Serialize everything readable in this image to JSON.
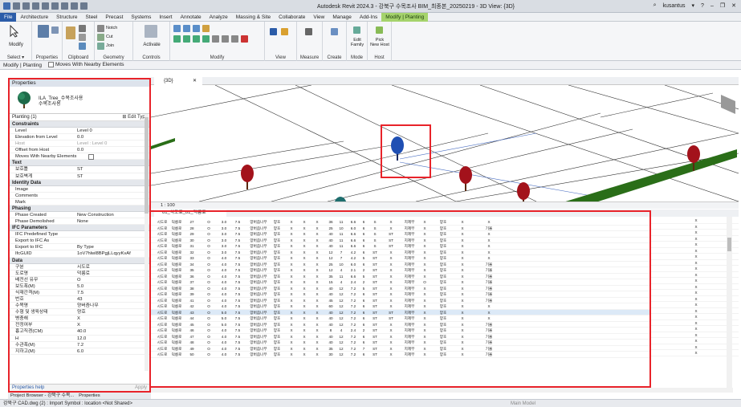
{
  "titlebar": {
    "app_title": "Autodesk Revit 2024.3 - 강북구 수목조사 BIM_최종본_20250219 - 3D View: {3D}",
    "user": "kusantus"
  },
  "ribbon_tabs": [
    "File",
    "Architecture",
    "Structure",
    "Steel",
    "Precast",
    "Systems",
    "Insert",
    "Annotate",
    "Analyze",
    "Massing & Site",
    "Collaborate",
    "View",
    "Manage",
    "Add-Ins",
    "Modify | Planting"
  ],
  "ribbon_groups": [
    "Select ▾",
    "Properties",
    "Clipboard",
    "Geometry",
    "Controls",
    "Modify",
    "View",
    "Measure",
    "Create",
    "Mode",
    "Host"
  ],
  "ribbon_labels": {
    "modify": "Modify",
    "cut": "Cut",
    "join": "Join",
    "notch": "Notch",
    "activate": "Activate",
    "edit_family": "Edit\nFamily",
    "pick_new_host": "Pick\nNew Host"
  },
  "options_bar": {
    "context": "Modify | Planting",
    "moves_with_nearby": "Moves With Nearby Elements"
  },
  "properties": {
    "header": "Properties",
    "type_name1": "ILA_Tree_수목조사용",
    "type_name2": "수목조사용",
    "instance": "Planting (1)",
    "edit_type": "Edit Type",
    "groups": [
      {
        "name": "Constraints",
        "rows": [
          [
            "Level",
            "Level 0"
          ],
          [
            "Elevation from Level",
            "0.0"
          ],
          [
            "Host",
            "Level : Level 0"
          ],
          [
            "Offset from Host",
            "0.0"
          ],
          [
            "Moves With Nearby Elements",
            ""
          ]
        ]
      },
      {
        "name": "Text",
        "rows": [
          [
            "보호틀",
            "ST"
          ],
          [
            "보호벽게",
            "ST"
          ]
        ]
      },
      {
        "name": "Identity Data",
        "rows": [
          [
            "Image",
            ""
          ],
          [
            "Comments",
            ""
          ],
          [
            "Mark",
            ""
          ]
        ]
      },
      {
        "name": "Phasing",
        "rows": [
          [
            "Phase Created",
            "New Construction"
          ],
          [
            "Phase Demolished",
            "None"
          ]
        ]
      },
      {
        "name": "IFC Parameters",
        "rows": [
          [
            "IFC Predefined Type",
            ""
          ],
          [
            "Export to IFC As",
            ""
          ],
          [
            "Export to IFC",
            "By Type"
          ],
          [
            "IfcGUID",
            "1oV7hlwl8BPgjLLqyyKvAf"
          ]
        ]
      },
      {
        "name": "Data",
        "rows": [
          [
            "구분",
            "시도로"
          ],
          [
            "도로명",
            "덕릉로"
          ],
          [
            "배전선 유무",
            "O"
          ],
          [
            "보도폭(M)",
            "5.0"
          ],
          [
            "식재간격(M)",
            "7.5"
          ],
          [
            "번호",
            "43"
          ],
          [
            "수목명",
            "양버즘나무"
          ],
          [
            "수형 및 생육상태",
            "양호"
          ],
          [
            "병충해",
            "X"
          ],
          [
            "전정여부",
            "X"
          ],
          [
            "흉고직경(CM)",
            "40.0"
          ],
          [
            "H",
            "12.0"
          ],
          [
            "수관폭(M)",
            "7.2"
          ],
          [
            "지하고(M)",
            "6.0"
          ]
        ]
      }
    ],
    "help": "Properties help",
    "apply": "Apply"
  },
  "bottom_tabs": [
    "Project Browser - 강북구 수목...",
    "Properties"
  ],
  "view": {
    "tab": "{3D}",
    "scale": "1 : 100"
  },
  "schedule": {
    "tab": "01_식도로_01_덕릉로",
    "rows": [
      [
        "시도로",
        "덕릉로",
        "27",
        "O",
        "3.0",
        "7.5",
        "양버즘나무",
        "양호",
        "X",
        "X",
        "X",
        "36",
        "11",
        "6.6",
        "6",
        "S",
        "X",
        "지제부",
        "X",
        "양호",
        "X",
        "X",
        "X"
      ],
      [
        "시도로",
        "덕릉로",
        "28",
        "O",
        "3.0",
        "7.5",
        "양버즘나무",
        "양호",
        "X",
        "X",
        "X",
        "25",
        "10",
        "6.0",
        "6",
        "S",
        "X",
        "지제부",
        "X",
        "양호",
        "X",
        "기울",
        "X"
      ],
      [
        "시도로",
        "덕릉로",
        "29",
        "O",
        "3.0",
        "7.5",
        "양버즘나무",
        "양호",
        "X",
        "X",
        "X",
        "40",
        "11",
        "6.6",
        "6",
        "S",
        "ST",
        "지제부",
        "X",
        "양호",
        "X",
        "X",
        "X"
      ],
      [
        "시도로",
        "덕릉로",
        "30",
        "O",
        "3.0",
        "7.5",
        "양버즘나무",
        "양호",
        "X",
        "X",
        "X",
        "40",
        "11",
        "6.6",
        "6",
        "S",
        "ST",
        "지제부",
        "X",
        "양호",
        "X",
        "X",
        "X"
      ],
      [
        "시도로",
        "덕릉로",
        "31",
        "O",
        "3.0",
        "7.5",
        "양버즘나무",
        "양호",
        "X",
        "X",
        "X",
        "40",
        "11",
        "6.6",
        "6",
        "S",
        "ST",
        "지제부",
        "X",
        "양호",
        "X",
        "X",
        "X"
      ],
      [
        "시도로",
        "덕릉로",
        "32",
        "O",
        "3.0",
        "7.5",
        "양버즘나무",
        "양호",
        "X",
        "X",
        "X",
        "12",
        "7",
        "4.2",
        "6",
        "ST",
        "X",
        "지제부",
        "X",
        "양호",
        "X",
        "X",
        "X"
      ],
      [
        "시도로",
        "덕릉로",
        "33",
        "O",
        "4.0",
        "7.5",
        "양버즘나무",
        "양호",
        "X",
        "X",
        "X",
        "12",
        "7",
        "4.2",
        "5",
        "ST",
        "X",
        "지제부",
        "X",
        "양호",
        "X",
        "X",
        "X"
      ],
      [
        "시도로",
        "덕릉로",
        "34",
        "O",
        "4.0",
        "7.5",
        "양버즘나무",
        "양호",
        "X",
        "X",
        "X",
        "25",
        "10",
        "6.0",
        "6",
        "ST",
        "X",
        "지제부",
        "X",
        "양호",
        "X",
        "기울",
        "X"
      ],
      [
        "시도로",
        "덕릉로",
        "35",
        "O",
        "4.0",
        "7.5",
        "양버즘나무",
        "양호",
        "X",
        "X",
        "X",
        "12",
        "4",
        "2.1",
        "2",
        "ST",
        "X",
        "지제부",
        "X",
        "양호",
        "X",
        "기울",
        "X"
      ],
      [
        "시도로",
        "덕릉로",
        "36",
        "O",
        "4.0",
        "7.5",
        "양버즘나무",
        "양호",
        "X",
        "X",
        "X",
        "35",
        "11",
        "6.6",
        "5",
        "ST",
        "X",
        "지제부",
        "X",
        "양호",
        "X",
        "기울",
        "X"
      ],
      [
        "시도로",
        "덕릉로",
        "37",
        "O",
        "4.0",
        "7.5",
        "양버즘나무",
        "양호",
        "X",
        "X",
        "X",
        "15",
        "4",
        "2.4",
        "2",
        "ST",
        "X",
        "지제부",
        "O",
        "양호",
        "X",
        "기울",
        "X"
      ],
      [
        "시도로",
        "덕릉로",
        "38",
        "O",
        "4.0",
        "7.5",
        "양버즘나무",
        "양호",
        "X",
        "X",
        "X",
        "40",
        "12",
        "7.2",
        "5",
        "ST",
        "X",
        "지제부",
        "X",
        "양호",
        "X",
        "기울",
        "X"
      ],
      [
        "시도로",
        "덕릉로",
        "39",
        "O",
        "4.0",
        "7.5",
        "양버즘나무",
        "양호",
        "X",
        "X",
        "X",
        "40",
        "12",
        "7.2",
        "6",
        "ST",
        "X",
        "지제부",
        "X",
        "양호",
        "X",
        "기울",
        "X"
      ],
      [
        "시도로",
        "덕릉로",
        "41",
        "O",
        "4.0",
        "7.5",
        "양버즘나무",
        "양호",
        "X",
        "X",
        "X",
        "45",
        "12",
        "7.2",
        "6",
        "ST",
        "X",
        "지제부",
        "X",
        "양호",
        "X",
        "기울",
        "X"
      ],
      [
        "시도로",
        "덕릉로",
        "42",
        "O",
        "4.0",
        "7.5",
        "양버즘나무",
        "양호",
        "X",
        "X",
        "X",
        "60",
        "12",
        "7.2",
        "6",
        "ST",
        "X",
        "지제부",
        "X",
        "양호",
        "X",
        "X",
        "X"
      ],
      [
        "시도로",
        "덕릉로",
        "43",
        "O",
        "5.0",
        "7.5",
        "양버즘나무",
        "양호",
        "X",
        "X",
        "X",
        "40",
        "12",
        "7.2",
        "6",
        "ST",
        "ST",
        "지제부",
        "X",
        "양호",
        "X",
        "X",
        "X"
      ],
      [
        "시도로",
        "덕릉로",
        "44",
        "O",
        "5.0",
        "7.5",
        "양버즘나무",
        "양호",
        "X",
        "X",
        "X",
        "40",
        "12",
        "7.2",
        "6",
        "ST",
        "ST",
        "지제부",
        "X",
        "양호",
        "X",
        "X",
        "X"
      ],
      [
        "시도로",
        "덕릉로",
        "45",
        "O",
        "5.0",
        "7.5",
        "양버즘나무",
        "양호",
        "X",
        "X",
        "X",
        "40",
        "12",
        "7.2",
        "6",
        "ST",
        "X",
        "지제부",
        "X",
        "양호",
        "X",
        "기울",
        "X"
      ],
      [
        "시도로",
        "덕릉로",
        "46",
        "O",
        "4.0",
        "7.5",
        "양버즘나무",
        "양호",
        "X",
        "X",
        "X",
        "8",
        "4",
        "2.4",
        "2",
        "ST",
        "X",
        "지제부",
        "X",
        "양호",
        "X",
        "기울",
        "X"
      ],
      [
        "시도로",
        "덕릉로",
        "47",
        "O",
        "4.0",
        "7.5",
        "양버즘나무",
        "양호",
        "X",
        "X",
        "X",
        "40",
        "12",
        "7.2",
        "6",
        "ST",
        "X",
        "지제부",
        "X",
        "양호",
        "X",
        "기울",
        "X"
      ],
      [
        "시도로",
        "덕릉로",
        "48",
        "O",
        "4.0",
        "7.5",
        "양버즘나무",
        "양호",
        "X",
        "X",
        "X",
        "40",
        "12",
        "7.2",
        "6",
        "ST",
        "X",
        "지제부",
        "X",
        "양호",
        "X",
        "기울",
        "X"
      ],
      [
        "시도로",
        "덕릉로",
        "49",
        "O",
        "4.0",
        "7.5",
        "양버즘나무",
        "양호",
        "X",
        "X",
        "X",
        "35",
        "12",
        "7.2",
        "7",
        "ST",
        "X",
        "지제부",
        "X",
        "양호",
        "X",
        "기울",
        "X"
      ],
      [
        "시도로",
        "덕릉로",
        "50",
        "O",
        "4.0",
        "7.5",
        "양버즘나무",
        "양호",
        "X",
        "X",
        "X",
        "30",
        "12",
        "7.2",
        "6",
        "ST",
        "X",
        "지제부",
        "X",
        "양호",
        "X",
        "기울",
        "X"
      ]
    ],
    "selected_row_index": 15
  },
  "status": {
    "text": "강북구 CAD.dwg (2) : Import Symbol : location <Not Shared>",
    "model": "Main Model"
  },
  "colors": {
    "highlight": "#e8232a",
    "tree_red": "#a3121b",
    "tree_blue": "#1f4fb3",
    "tree_teal": "#1e6e6e",
    "hedge": "#2a6e18",
    "file_tab": "#2b5ca8",
    "context_tab": "#a5d36c"
  }
}
